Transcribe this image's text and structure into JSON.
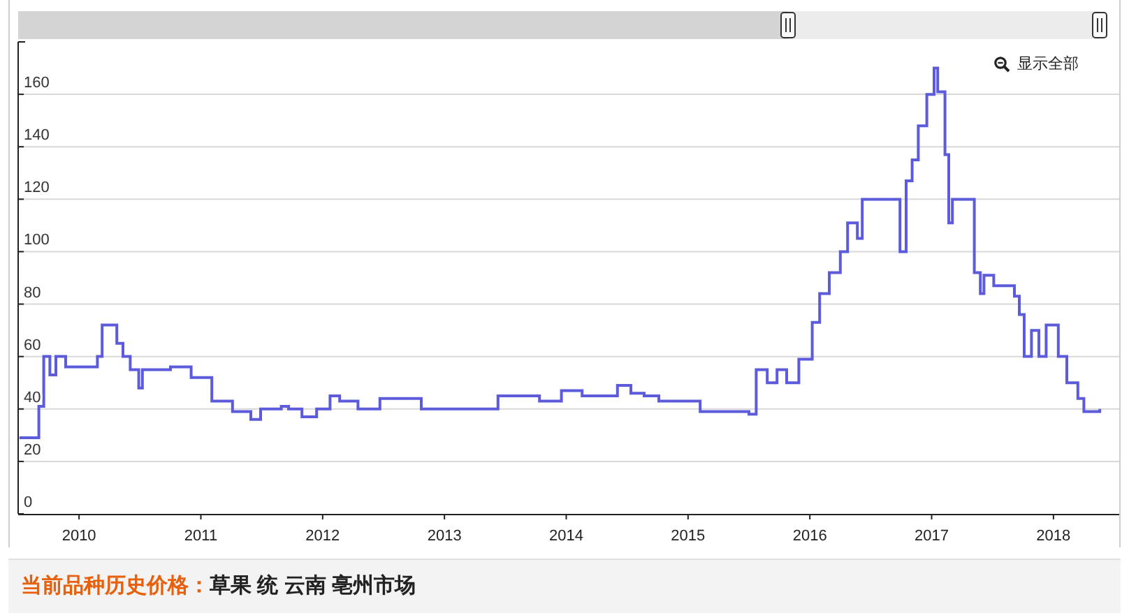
{
  "zoom_button": {
    "label": "显示全部"
  },
  "chart_data": {
    "type": "line",
    "grid": true,
    "xlim": [
      2009.5,
      2018.54
    ],
    "ylim": [
      0,
      180
    ],
    "xticks": [
      2010,
      2011,
      2012,
      2013,
      2014,
      2015,
      2016,
      2017,
      2018
    ],
    "yticks": [
      0,
      20,
      40,
      60,
      80,
      100,
      120,
      140,
      160
    ],
    "series": [
      {
        "color": "#5b5bdc",
        "x": [
          2009.51,
          2009.67,
          2009.67,
          2009.71,
          2009.71,
          2009.76,
          2009.76,
          2009.81,
          2009.81,
          2009.89,
          2009.89,
          2010.15,
          2010.15,
          2010.19,
          2010.19,
          2010.31,
          2010.31,
          2010.36,
          2010.36,
          2010.42,
          2010.42,
          2010.49,
          2010.49,
          2010.52,
          2010.52,
          2010.75,
          2010.75,
          2010.92,
          2010.92,
          2011.09,
          2011.09,
          2011.26,
          2011.26,
          2011.41,
          2011.41,
          2011.49,
          2011.49,
          2011.66,
          2011.66,
          2011.72,
          2011.72,
          2011.83,
          2011.83,
          2011.95,
          2011.95,
          2012.06,
          2012.06,
          2012.14,
          2012.14,
          2012.29,
          2012.29,
          2012.47,
          2012.47,
          2012.81,
          2012.81,
          2013.44,
          2013.44,
          2013.78,
          2013.78,
          2013.96,
          2013.96,
          2014.13,
          2014.13,
          2014.42,
          2014.42,
          2014.53,
          2014.53,
          2014.64,
          2014.64,
          2014.76,
          2014.76,
          2015.1,
          2015.1,
          2015.5,
          2015.5,
          2015.56,
          2015.56,
          2015.65,
          2015.65,
          2015.73,
          2015.73,
          2015.81,
          2015.81,
          2015.91,
          2015.91,
          2016.02,
          2016.02,
          2016.08,
          2016.08,
          2016.16,
          2016.16,
          2016.25,
          2016.25,
          2016.31,
          2016.31,
          2016.39,
          2016.39,
          2016.43,
          2016.43,
          2016.74,
          2016.74,
          2016.79,
          2016.79,
          2016.84,
          2016.84,
          2016.89,
          2016.89,
          2016.96,
          2016.96,
          2017.02,
          2017.02,
          2017.05,
          2017.05,
          2017.11,
          2017.11,
          2017.14,
          2017.14,
          2017.17,
          2017.17,
          2017.35,
          2017.35,
          2017.4,
          2017.4,
          2017.43,
          2017.43,
          2017.51,
          2017.51,
          2017.68,
          2017.68,
          2017.72,
          2017.72,
          2017.76,
          2017.76,
          2017.82,
          2017.82,
          2017.88,
          2017.88,
          2017.94,
          2017.94,
          2018.04,
          2018.04,
          2018.11,
          2018.11,
          2018.2,
          2018.2,
          2018.25,
          2018.25,
          2018.38,
          2018.38
        ],
        "values": [
          29,
          29,
          41,
          41,
          60,
          60,
          53,
          53,
          60,
          60,
          56,
          56,
          60,
          60,
          72,
          72,
          65,
          65,
          60,
          60,
          55,
          55,
          48,
          48,
          55,
          55,
          56,
          56,
          52,
          52,
          43,
          43,
          39,
          39,
          36,
          36,
          40,
          40,
          41,
          41,
          40,
          40,
          37,
          37,
          40,
          40,
          45,
          45,
          43,
          43,
          40,
          40,
          44,
          44,
          40,
          40,
          45,
          45,
          43,
          43,
          47,
          47,
          45,
          45,
          49,
          49,
          46,
          46,
          45,
          45,
          43,
          43,
          39,
          39,
          38,
          38,
          55,
          55,
          50,
          50,
          55,
          55,
          50,
          50,
          59,
          59,
          73,
          73,
          84,
          84,
          92,
          92,
          100,
          100,
          111,
          111,
          105,
          105,
          120,
          120,
          100,
          100,
          127,
          127,
          135,
          135,
          148,
          148,
          160,
          160,
          170,
          170,
          161,
          161,
          137,
          137,
          111,
          111,
          120,
          120,
          92,
          92,
          84,
          84,
          91,
          91,
          87,
          87,
          83,
          83,
          76,
          76,
          60,
          60,
          70,
          70,
          60,
          60,
          72,
          72,
          60,
          60,
          50,
          50,
          44,
          44,
          39,
          39,
          40
        ]
      }
    ]
  },
  "caption": {
    "label": "当前品种历史价格：",
    "value": "草果 统 云南 亳州市场"
  }
}
